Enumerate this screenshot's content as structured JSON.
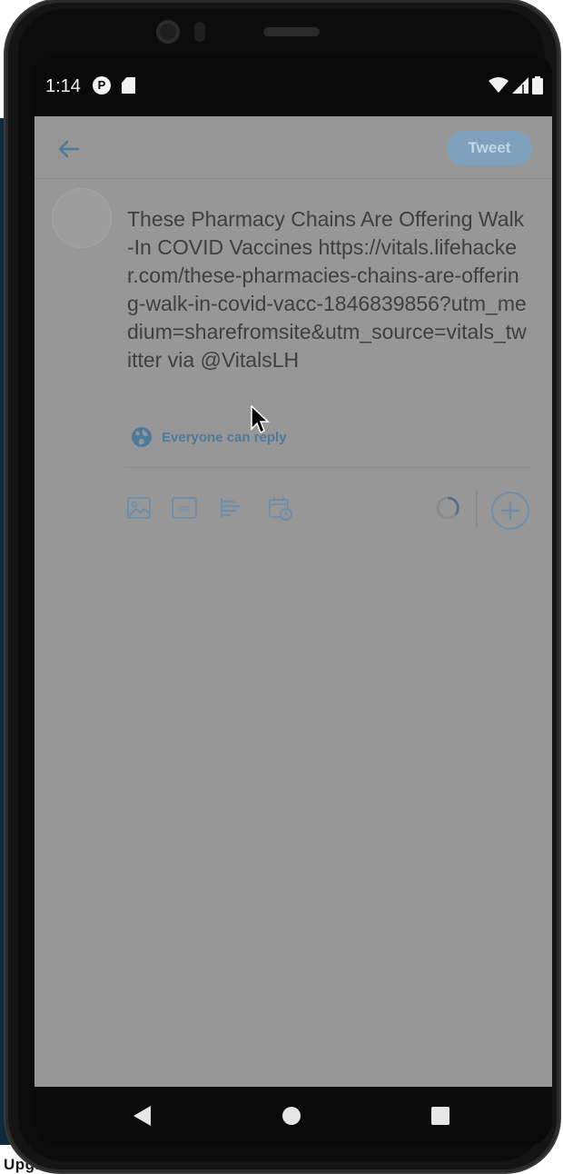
{
  "status_bar": {
    "time": "1:14",
    "notification_icon_letter": "P"
  },
  "toolbar": {
    "tweet_label": "Tweet"
  },
  "compose": {
    "text": "These Pharmacy Chains Are Offering Walk-In COVID Vaccines https://vitals.lifehacker.com/these-pharmacies-chains-are-offering-walk-in-covid-vacc-1846839856?utm_medium=sharefromsite&utm_source=vitals_twitter via @VitalsLH",
    "reply_setting": "Everyone can reply"
  },
  "background": {
    "cut_off_label": "Upgrad"
  },
  "icons": {
    "back": "back-arrow-icon",
    "globe": "globe-icon",
    "image": "image-icon",
    "gif": "gif-icon",
    "poll": "poll-icon",
    "schedule": "schedule-icon",
    "progress": "character-count-ring-icon",
    "add": "add-tweet-icon",
    "nav_back": "triangle-back-icon",
    "nav_home": "circle-home-icon",
    "nav_recents": "square-recents-icon"
  },
  "colors": {
    "overlay_gray": "#979797",
    "accent_blue": "#4f7a9a",
    "tweet_button": "#7ea2bd"
  }
}
